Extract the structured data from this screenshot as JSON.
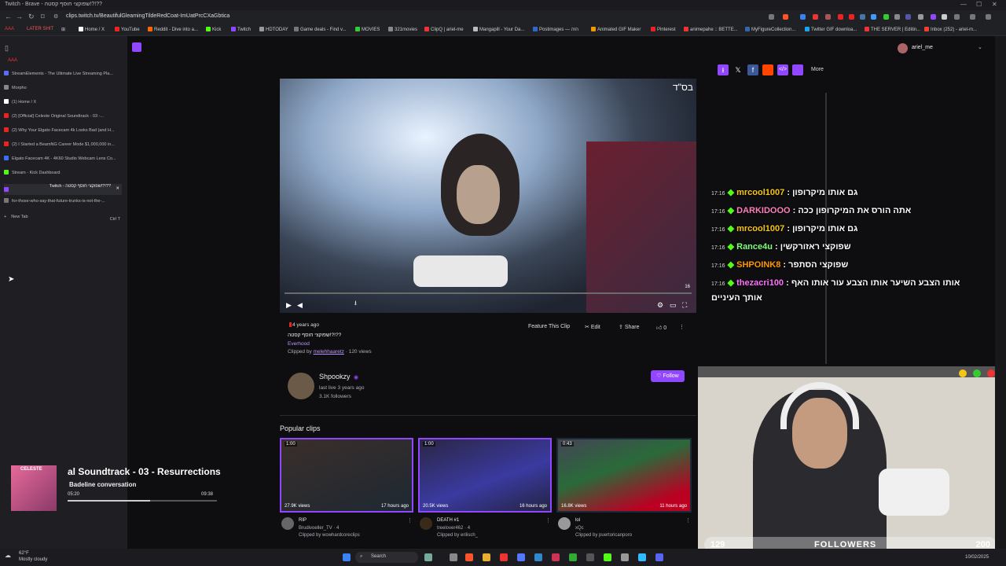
{
  "window": {
    "title": "Twitch - Brave - שפוקצי חוסף קסטה!?!??"
  },
  "browser": {
    "url": "clips.twitch.tv/BeautifulGleamingTildeRedCoat-ImUatPrcCXaGbtica",
    "bookmarks": [
      "AAA",
      "LATER SHIT",
      "Home / X",
      "YouTube",
      "Reddit - Dive into a...",
      "Kick",
      "Twitch",
      "HDTODAY",
      "Game deals - Find v...",
      "MOVIES",
      "321movies",
      "ClipQ | ariel-me",
      "Mangapill - Your Da...",
      "Postimages — הזה",
      "Animated GIF Maker",
      "Pinterest",
      "animepahe :: BETTE...",
      "MyFigureCollection...",
      "Twitter GIF downloa...",
      "THE SERVER | Editin...",
      "Inbox (252) - ariel-m..."
    ]
  },
  "sidebar": {
    "heading": "AAA",
    "tabs": [
      {
        "label": "StreamElements - The Ultimate Live Streaming Pla...",
        "color": "#5b6bff"
      },
      {
        "label": "Morpho",
        "color": "#888"
      },
      {
        "label": "(1) Home / X",
        "color": "#fff"
      },
      {
        "label": "(2) [Official] Celeste Original Soundtrack - 03 -...",
        "color": "#e22"
      },
      {
        "label": "(2) Why Your Elgato Facecam 4k Looks Bad (and H...",
        "color": "#e22"
      },
      {
        "label": "(2) I Started a BeamNG Career Mode $1,000,000 in...",
        "color": "#e22"
      },
      {
        "label": "Elgato Facecam 4K - 4K60 Studio Webcam Lens Co...",
        "color": "#3b6cff"
      },
      {
        "label": "Stream - Kick Dashboard",
        "color": "#53fc18"
      },
      {
        "label": "Twitch - שפוקצי חוסף קסטה!?!??",
        "color": "#9147ff",
        "active": true
      },
      {
        "label": "for-those-who-say-that-future-trunks-is-not-the-...",
        "color": "#777"
      }
    ],
    "new_tab": "New Tab",
    "new_tab_shortcut": "Ctrl T"
  },
  "user": {
    "name": "ariel_me"
  },
  "share_bar": {
    "more_label": "More"
  },
  "video": {
    "overlay_text": "בס\"ד",
    "quality": "16"
  },
  "clip": {
    "age": "4 years ago",
    "title": "שפוקצי חוסף קסטה!?!??",
    "category": "Everhood",
    "clipped_by_prefix": "Clipped by",
    "clipper": "melehhaaretz",
    "views": "· 120 views",
    "actions": {
      "feature": "Feature This Clip",
      "edit": "Edit",
      "share": "Share",
      "likes": "0"
    }
  },
  "channel": {
    "name": "Shpookzy",
    "last_live": "last live 3 years ago",
    "followers": "3.1K followers",
    "follow_label": "Follow"
  },
  "popular": {
    "heading": "Popular clips",
    "clips": [
      {
        "duration": "1:00",
        "views": "27.9K views",
        "ago": "17 hours ago",
        "title": "RIP",
        "channel": "Brudivoeller_TV",
        "extra": "· 4",
        "clipper": "Clipped by wowhardcoreclips"
      },
      {
        "duration": "1:00",
        "views": "20.5K views",
        "ago": "16 hours ago",
        "title": "DEATH #1",
        "channel": "treelover462",
        "extra": "· 4",
        "clipper": "Clipped by erilisch_"
      },
      {
        "duration": "0:43",
        "views": "16.8K views",
        "ago": "11 hours ago",
        "title": "lol",
        "channel": "xQc",
        "extra": "",
        "clipper": "Clipped by puertoricanporo"
      }
    ]
  },
  "chat": [
    {
      "time": "17:16",
      "user": "mrcool1007",
      "color": "#f5c518",
      "msg": "גם אותו מיקרופון"
    },
    {
      "time": "17:16",
      "user": "DARKIDOOO",
      "color": "#ff7fbf",
      "msg": "אתה הורס את המיקרופון ככה"
    },
    {
      "time": "17:16",
      "user": "mrcool1007",
      "color": "#f5c518",
      "msg": "גם אותו מיקרופון"
    },
    {
      "time": "17:16",
      "user": "Rance4u",
      "color": "#7fff7f",
      "msg": "שפוקצי ראזורקשין"
    },
    {
      "time": "17:16",
      "user": "SHPOINK8",
      "color": "#ff9900",
      "msg": "שפוקצי הסתפר"
    },
    {
      "time": "17:16",
      "user": "thezacri100",
      "color": "#ff6fff",
      "msg": "אותו הצבע השיער אותו הצבע עור אותו האף"
    },
    {
      "time": "",
      "user": "",
      "color": "#fff",
      "msg": "אותך העיניים"
    }
  ],
  "follow_goal": {
    "current": "129",
    "label": "FOLLOWERS",
    "target": "200"
  },
  "now_playing": {
    "game": "CELESTE",
    "track": "al Soundtrack - 03 - Resurrections",
    "subtitle": "Badeline conversation",
    "elapsed": "05:20",
    "total": "09:38"
  },
  "taskbar": {
    "weather_temp": "62°F",
    "weather_desc": "Mostly cloudy",
    "search_label": "Search",
    "date": "10/02/2025"
  }
}
